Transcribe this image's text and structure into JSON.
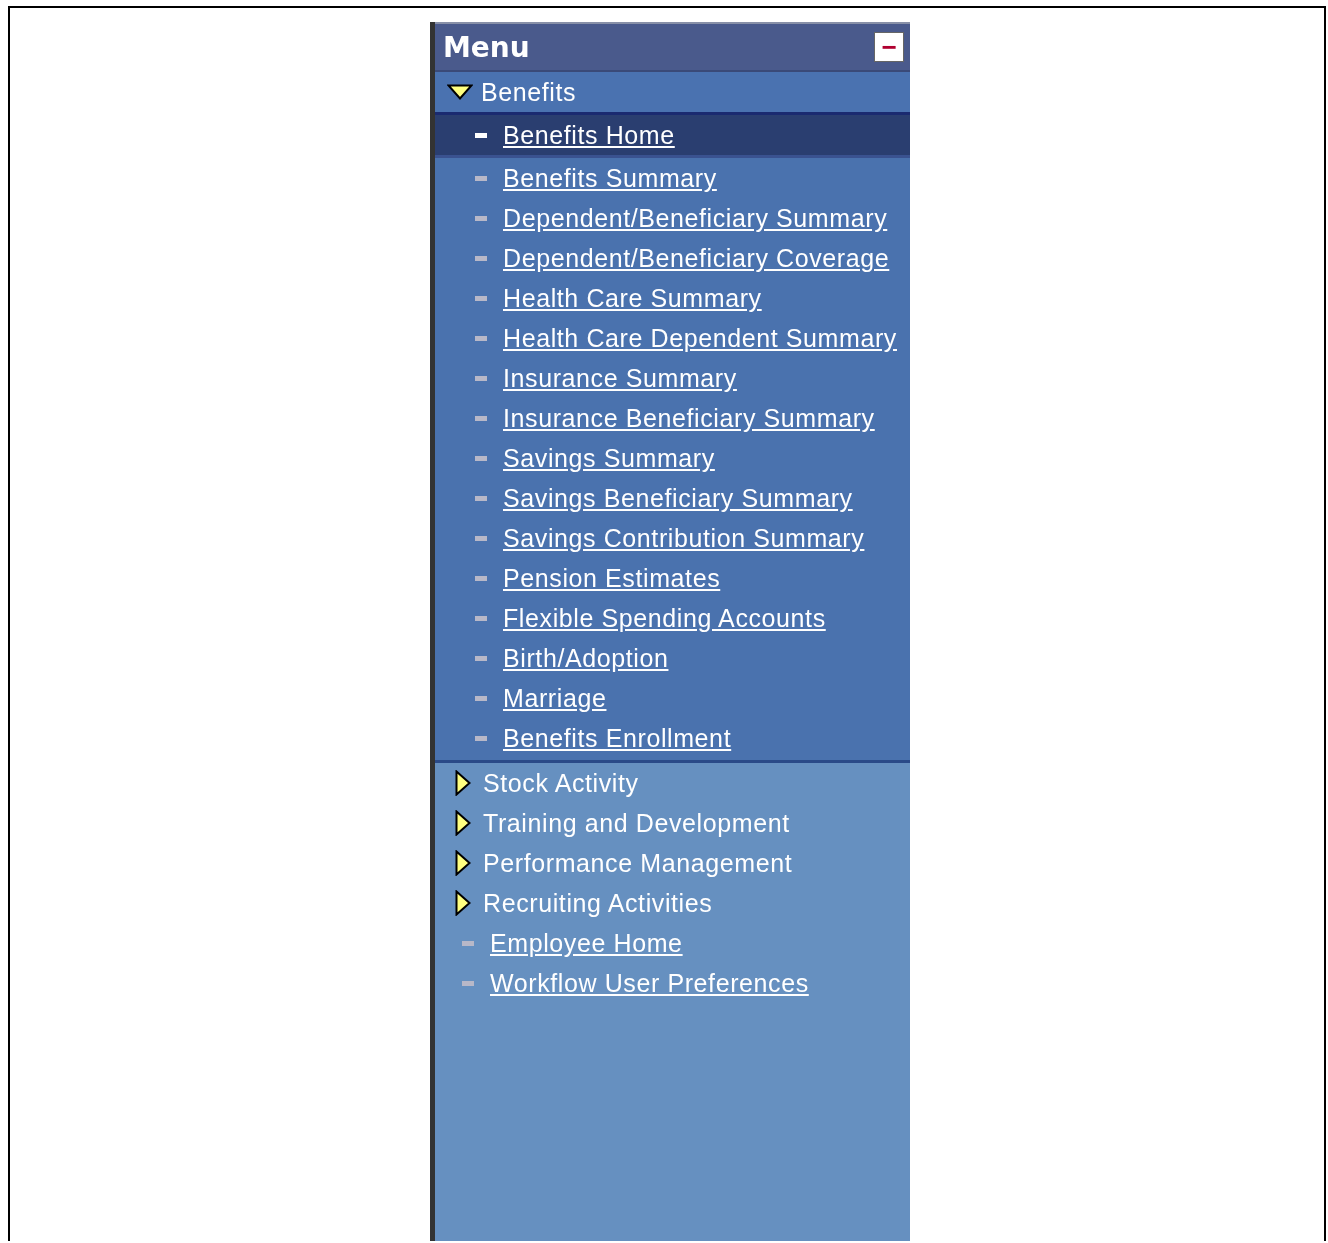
{
  "menu": {
    "title": "Menu",
    "collapse_button": {
      "label": "−"
    },
    "items": [
      {
        "kind": "folder",
        "label": "Benefits",
        "expanded": true,
        "children": [
          {
            "kind": "link",
            "label": "Benefits Home",
            "selected": true
          },
          {
            "kind": "link",
            "label": "Benefits Summary",
            "selected": false
          },
          {
            "kind": "link",
            "label": "Dependent/Beneficiary Summary",
            "selected": false
          },
          {
            "kind": "link",
            "label": "Dependent/Beneficiary Coverage",
            "selected": false
          },
          {
            "kind": "link",
            "label": "Health Care Summary",
            "selected": false
          },
          {
            "kind": "link",
            "label": "Health Care Dependent Summary",
            "selected": false
          },
          {
            "kind": "link",
            "label": "Insurance Summary",
            "selected": false
          },
          {
            "kind": "link",
            "label": "Insurance Beneficiary Summary",
            "selected": false
          },
          {
            "kind": "link",
            "label": "Savings Summary",
            "selected": false
          },
          {
            "kind": "link",
            "label": "Savings Beneficiary Summary",
            "selected": false
          },
          {
            "kind": "link",
            "label": "Savings Contribution Summary",
            "selected": false
          },
          {
            "kind": "link",
            "label": "Pension Estimates",
            "selected": false
          },
          {
            "kind": "link",
            "label": "Flexible Spending Accounts",
            "selected": false
          },
          {
            "kind": "link",
            "label": "Birth/Adoption",
            "selected": false
          },
          {
            "kind": "link",
            "label": "Marriage",
            "selected": false
          },
          {
            "kind": "link",
            "label": "Benefits Enrollment",
            "selected": false
          }
        ]
      },
      {
        "kind": "folder",
        "label": "Stock Activity",
        "expanded": false
      },
      {
        "kind": "folder",
        "label": "Training and Development",
        "expanded": false
      },
      {
        "kind": "folder",
        "label": "Performance Management",
        "expanded": false
      },
      {
        "kind": "folder",
        "label": "Recruiting Activities",
        "expanded": false
      },
      {
        "kind": "link",
        "label": "Employee Home",
        "selected": false
      },
      {
        "kind": "link",
        "label": "Workflow User Preferences",
        "selected": false
      }
    ]
  }
}
